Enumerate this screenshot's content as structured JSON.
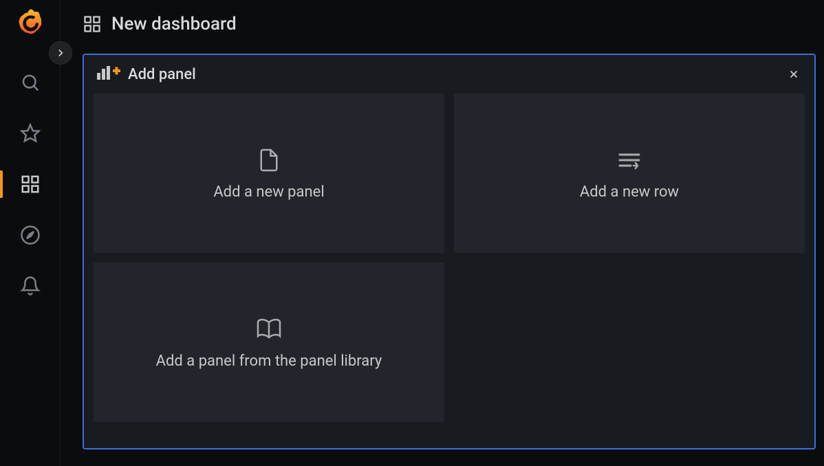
{
  "header": {
    "title": "New dashboard"
  },
  "sidebar": {
    "items": [
      {
        "name": "search"
      },
      {
        "name": "favorites"
      },
      {
        "name": "dashboards"
      },
      {
        "name": "explore"
      },
      {
        "name": "alerts"
      }
    ]
  },
  "panel": {
    "title": "Add panel",
    "options": [
      {
        "label": "Add a new panel",
        "icon": "file"
      },
      {
        "label": "Add a new row",
        "icon": "rows"
      },
      {
        "label": "Add a panel from the panel library",
        "icon": "book"
      }
    ]
  }
}
